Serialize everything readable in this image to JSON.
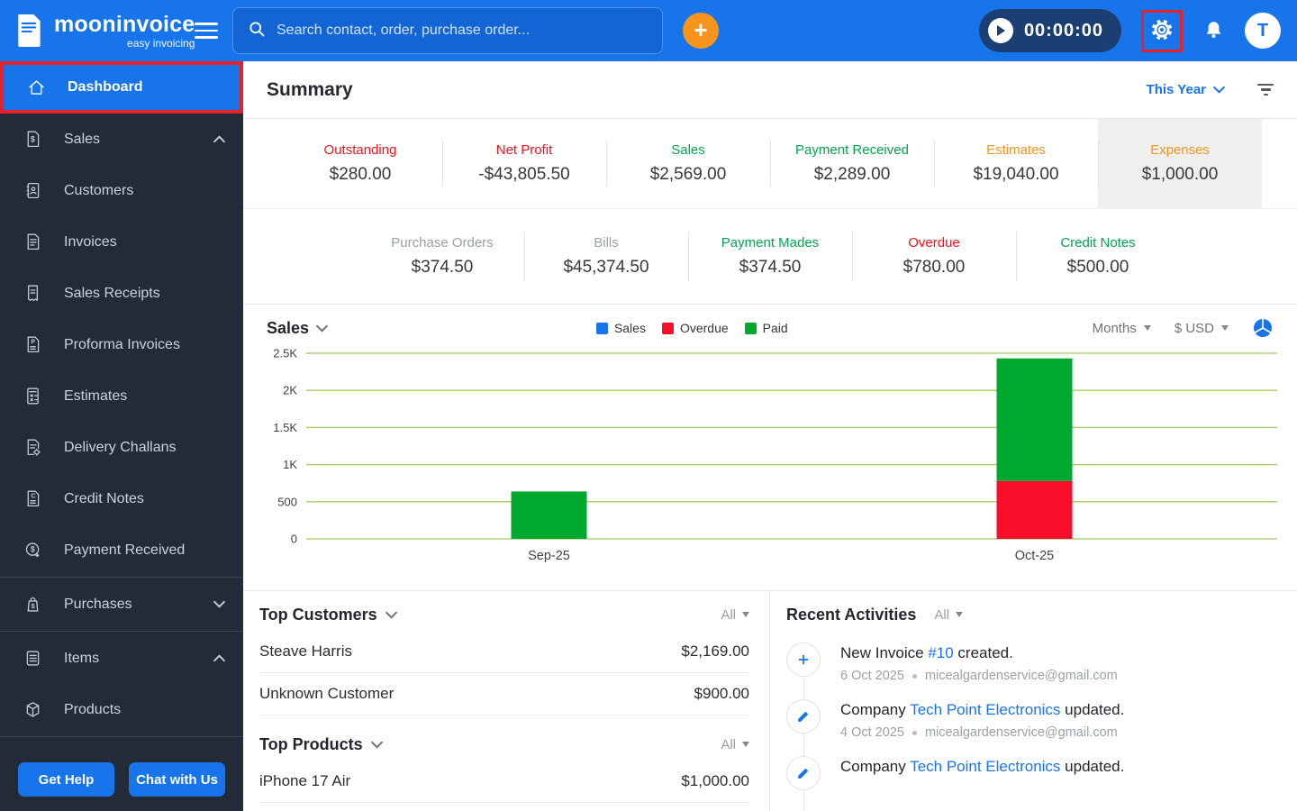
{
  "topbar": {
    "brand": {
      "name": "mooninvoice",
      "tagline": "easy invoicing"
    },
    "search": {
      "placeholder": "Search contact, order, purchase order..."
    },
    "timer": "00:00:00",
    "avatar_initial": "T"
  },
  "sidebar": {
    "items": [
      {
        "label": "Dashboard",
        "active": true
      },
      {
        "label": "Sales",
        "expanded": true
      },
      {
        "label": "Customers"
      },
      {
        "label": "Invoices"
      },
      {
        "label": "Sales Receipts"
      },
      {
        "label": "Proforma Invoices"
      },
      {
        "label": "Estimates"
      },
      {
        "label": "Delivery Challans"
      },
      {
        "label": "Credit Notes"
      },
      {
        "label": "Payment Received"
      },
      {
        "label": "Purchases",
        "expanded": false
      },
      {
        "label": "Items",
        "expanded": true
      },
      {
        "label": "Products"
      }
    ],
    "buttons": [
      {
        "label": "Get Help"
      },
      {
        "label": "Chat with Us"
      }
    ]
  },
  "summary": {
    "title": "Summary",
    "period": "This Year",
    "cards_row1": [
      {
        "label": "Outstanding",
        "value": "$280.00",
        "color": "#f6111b"
      },
      {
        "label": "Net Profit",
        "value": "-$43,805.50",
        "color": "#f6111b"
      },
      {
        "label": "Sales",
        "value": "$2,569.00",
        "color": "#00a64f"
      },
      {
        "label": "Payment Received",
        "value": "$2,289.00",
        "color": "#00a64f"
      },
      {
        "label": "Estimates",
        "value": "$19,040.00",
        "color": "#f7941d"
      },
      {
        "label": "Expenses",
        "value": "$1,000.00",
        "color": "#f7941d",
        "highlighted": true
      }
    ],
    "cards_row2": [
      {
        "label": "Purchase Orders",
        "value": "$374.50",
        "color": "#9aa0a6"
      },
      {
        "label": "Bills",
        "value": "$45,374.50",
        "color": "#9aa0a6"
      },
      {
        "label": "Payment Mades",
        "value": "$374.50",
        "color": "#00a64f"
      },
      {
        "label": "Overdue",
        "value": "$780.00",
        "color": "#f6111b"
      },
      {
        "label": "Credit Notes",
        "value": "$500.00",
        "color": "#00a64f"
      }
    ]
  },
  "chart_section": {
    "title": "Sales",
    "interval_label": "Months",
    "currency_label": "$ USD"
  },
  "chart_data": {
    "type": "bar",
    "stacked": true,
    "categories": [
      "Sep-25",
      "Oct-25"
    ],
    "series": [
      {
        "name": "Sales",
        "color": "#1774ea",
        "values": [
          0,
          0
        ]
      },
      {
        "name": "Overdue",
        "color": "#f80d2b",
        "values": [
          0,
          780
        ]
      },
      {
        "name": "Paid",
        "color": "#00a82e",
        "values": [
          638.5,
          1650.5
        ]
      }
    ],
    "title": "Sales",
    "xlabel": "",
    "ylabel": "",
    "ylim": [
      0,
      2500
    ],
    "yticks": [
      0,
      500,
      1000,
      1500,
      2000,
      2500
    ],
    "ytick_labels": [
      "0",
      "500",
      "1K",
      "1.5K",
      "2K",
      "2.5K"
    ],
    "grid": true,
    "gridline_color": "#a5cb5f",
    "legend_position": "top"
  },
  "top_customers": {
    "title": "Top Customers",
    "filter": "All",
    "rows": [
      {
        "name": "Steave Harris",
        "amount": "$2,169.00"
      },
      {
        "name": "Unknown Customer",
        "amount": "$900.00"
      }
    ]
  },
  "top_products": {
    "title": "Top Products",
    "filter": "All",
    "rows": [
      {
        "name": "iPhone 17 Air",
        "amount": "$1,000.00"
      }
    ]
  },
  "recent_activities": {
    "title": "Recent Activities",
    "filter": "All",
    "items": [
      {
        "icon": "plus-icon",
        "prefix": "New Invoice ",
        "link": "#10",
        "suffix": " created.",
        "date": "6 Oct 2025",
        "email": "micealgardenservice@gmail.com"
      },
      {
        "icon": "pencil-icon",
        "prefix": "Company ",
        "link": "Tech Point Electronics",
        "suffix": " updated.",
        "date": "4 Oct 2025",
        "email": "micealgardenservice@gmail.com"
      },
      {
        "icon": "pencil-icon",
        "prefix": "Company ",
        "link": "Tech Point Electronics",
        "suffix": " updated."
      }
    ]
  },
  "colors": {
    "brand_blue": "#1774ea",
    "sidebar_bg": "#222b37",
    "annotation_red": "#e62129",
    "accent_orange": "#f7941d",
    "timer_bg": "#1b3f72",
    "bar_green": "#00a82e",
    "bar_red": "#f80d2b"
  }
}
